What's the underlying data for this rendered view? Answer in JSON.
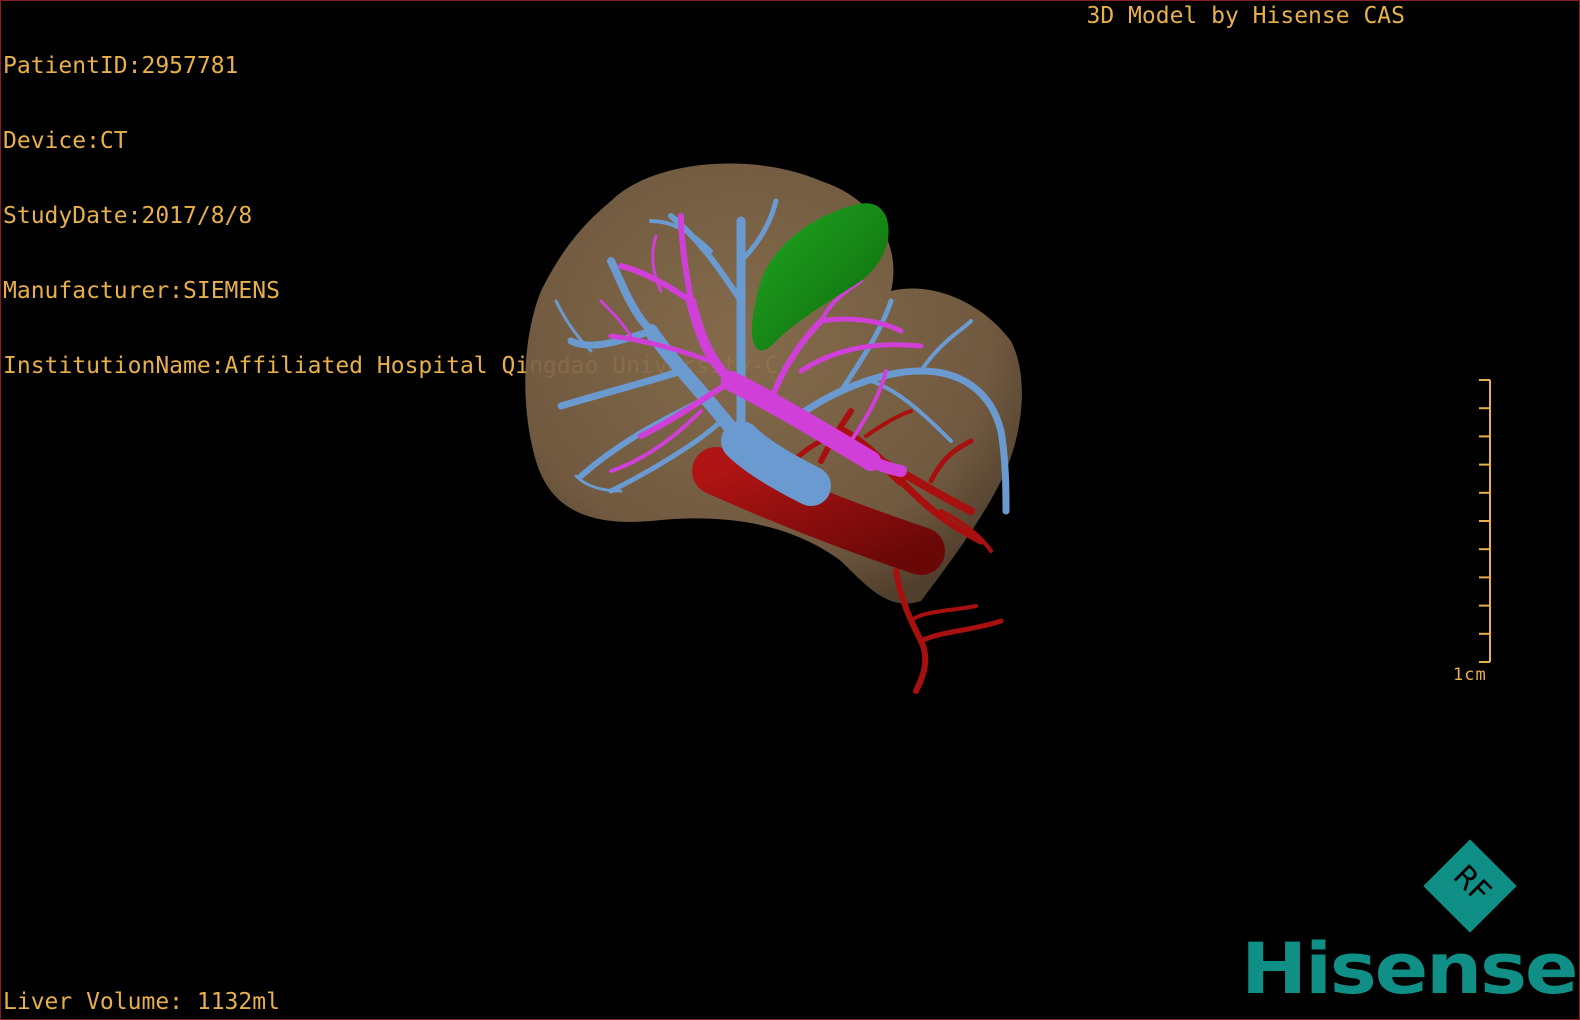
{
  "patient_info": {
    "patient_id": "PatientID:2957781",
    "device": "Device:CT",
    "study_date": "StudyDate:2017/8/8",
    "manufacturer": "Manufacturer:SIEMENS",
    "institution": "InstitutionName:Affiliated Hospital Qingdao University-C"
  },
  "model_credit": "3D Model by Hisense CAS",
  "liver_volume": "Liver Volume: 1132ml",
  "scale": {
    "label": "1cm",
    "tick_count": 11
  },
  "logo": {
    "badge_text": "RF",
    "brand": "Hisense"
  },
  "colors": {
    "overlay_text": "#e8b04a",
    "liver": "#8c7150",
    "hepatic_vein": "#6a9ad0",
    "portal_vein": "#d040d8",
    "gallbladder": "#168a16",
    "artery": "#a81010",
    "brand": "#0f8f86"
  }
}
